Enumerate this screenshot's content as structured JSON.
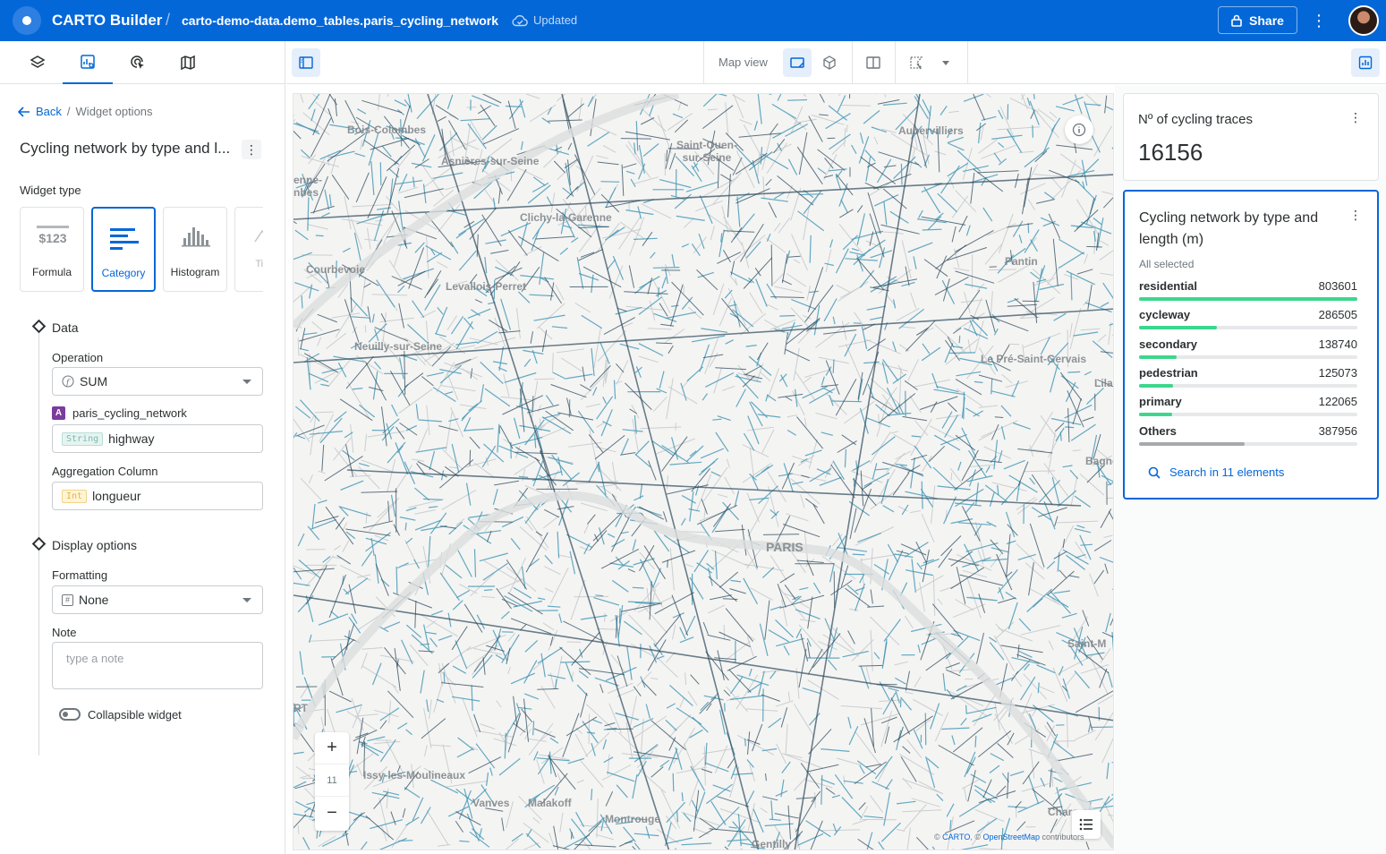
{
  "header": {
    "app_title": "CARTO Builder",
    "separator": "/",
    "dataset": "carto-demo-data.demo_tables.paris_cycling_network",
    "status": "Updated",
    "share_label": "Share"
  },
  "left_panel": {
    "tabs": [
      "layers-icon",
      "widgets-icon",
      "interactions-icon",
      "basemap-icon"
    ],
    "active_tab": 1,
    "breadcrumb": {
      "back": "Back",
      "separator": "/",
      "current": "Widget options"
    },
    "widget_title": "Cycling network by type and l...",
    "widget_type_label": "Widget type",
    "widget_types": [
      {
        "label": "Formula",
        "glyph": "$123"
      },
      {
        "label": "Category"
      },
      {
        "label": "Histogram"
      },
      {
        "label": "Ti Se"
      }
    ],
    "selected_widget_type": "Category",
    "data_section": "Data",
    "operation_label": "Operation",
    "operation_value": "SUM",
    "source_badge": "A",
    "source_name": "paris_cycling_network",
    "column_type": "String",
    "column_value": "highway",
    "aggregation_label": "Aggregation Column",
    "aggregation_type": "Int",
    "aggregation_value": "longueur",
    "display_section": "Display options",
    "formatting_label": "Formatting",
    "formatting_value": "None",
    "note_label": "Note",
    "note_placeholder": "type a note",
    "collapsible_label": "Collapsible widget",
    "collapsible_on": false
  },
  "toolbar": {
    "map_view_label": "Map view"
  },
  "map": {
    "zoom_in": "+",
    "zoom_level": "11",
    "zoom_out": "−",
    "labels": [
      "Bois-Colombes",
      "Asnières-sur-Seine",
      "Saint-Ouen-sur-Seine",
      "Aubervilliers",
      "Clichy-la-Garenne",
      "Courbevoie",
      "Levallois-Perret",
      "Neuilly-sur-Seine",
      "Pantin",
      "Le Pré-Saint-Gervais",
      "PARIS",
      "Bagnol",
      "Issy-les-Moulineaux",
      "Vanves",
      "Malakoff",
      "Montrouge",
      "Gentilly",
      "Saint-M",
      "Chare",
      "RT",
      "enne-nbes",
      "Lilas"
    ],
    "attribution": {
      "pre": "© ",
      "carto": "CARTO",
      "mid": ", © ",
      "osm": "OpenStreetMap",
      "post": " contributors"
    },
    "network_colors": {
      "secondary": "#4a9bb8",
      "primary": "#2d4a5c",
      "background": "#f4f4f3"
    }
  },
  "widgets": {
    "formula": {
      "title": "Nº of cycling traces",
      "value": "16156"
    },
    "category": {
      "title": "Cycling network by type and length (m)",
      "selection": "All selected",
      "search_label": "Search in 11 elements",
      "max": 803601
    }
  },
  "chart_data": {
    "type": "bar",
    "title": "Cycling network by type and length (m)",
    "categories": [
      "residential",
      "cycleway",
      "secondary",
      "pedestrian",
      "primary",
      "Others"
    ],
    "values": [
      803601,
      286505,
      138740,
      125073,
      122065,
      387956
    ],
    "display_values": [
      "803601",
      "286505",
      "138740",
      "125073",
      "122065",
      "387956"
    ]
  }
}
